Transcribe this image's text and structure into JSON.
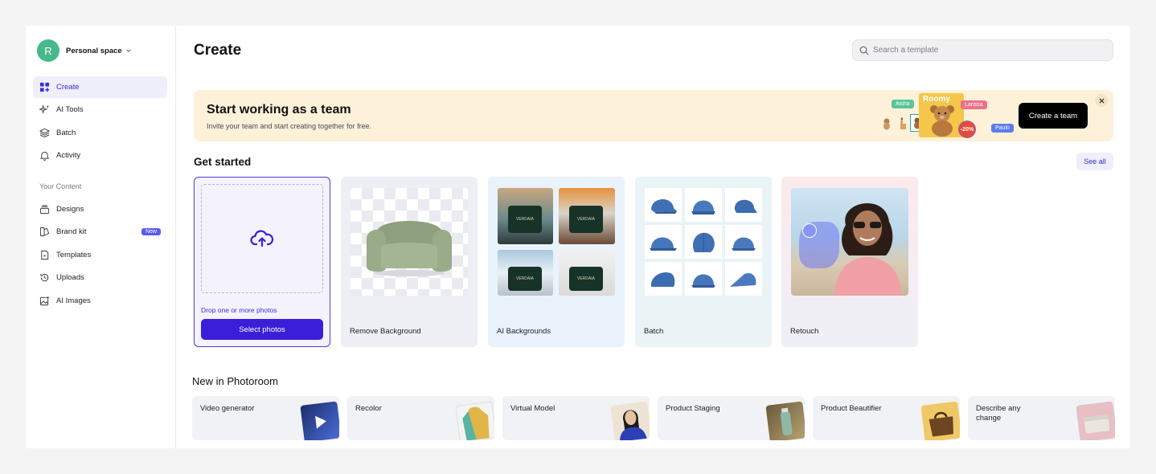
{
  "workspace": {
    "avatar_letter": "R",
    "name": "Personal space",
    "avatar_color": "#45b98a"
  },
  "nav": {
    "create": "Create",
    "ai_tools": "AI Tools",
    "batch": "Batch",
    "activity": "Activity",
    "section_label": "Your Content",
    "designs": "Designs",
    "brand_kit": "Brand kit",
    "brand_kit_badge": "New",
    "templates": "Templates",
    "uploads": "Uploads",
    "ai_images": "AI Images"
  },
  "header": {
    "title": "Create",
    "search_placeholder": "Search a template"
  },
  "banner": {
    "title": "Start working as a team",
    "subtitle": "Invite your team and start creating together for free.",
    "button": "Create a team",
    "tags": {
      "aisha": "Aisha",
      "larissa": "Larissa",
      "paulo": "Paulo",
      "brand": "Roomy",
      "discount": "-20%"
    }
  },
  "get_started": {
    "title": "Get started",
    "see_all": "See all",
    "upload": {
      "drop_text": "Drop one or more photos",
      "button": "Select photos"
    },
    "cards": {
      "remove_bg": "Remove Background",
      "ai_bg": "AI Backgrounds",
      "batch": "Batch",
      "retouch": "Retouch"
    },
    "product_brand": "VERDAIA"
  },
  "new_in": {
    "title": "New in Photoroom",
    "items": [
      "Video generator",
      "Recolor",
      "Virtual Model",
      "Product Staging",
      "Product Beautifier",
      "Describe any change"
    ]
  },
  "colors": {
    "accent": "#3a1fd9",
    "accent_soft": "#efeefb",
    "banner_bg": "#fdf1d9"
  }
}
